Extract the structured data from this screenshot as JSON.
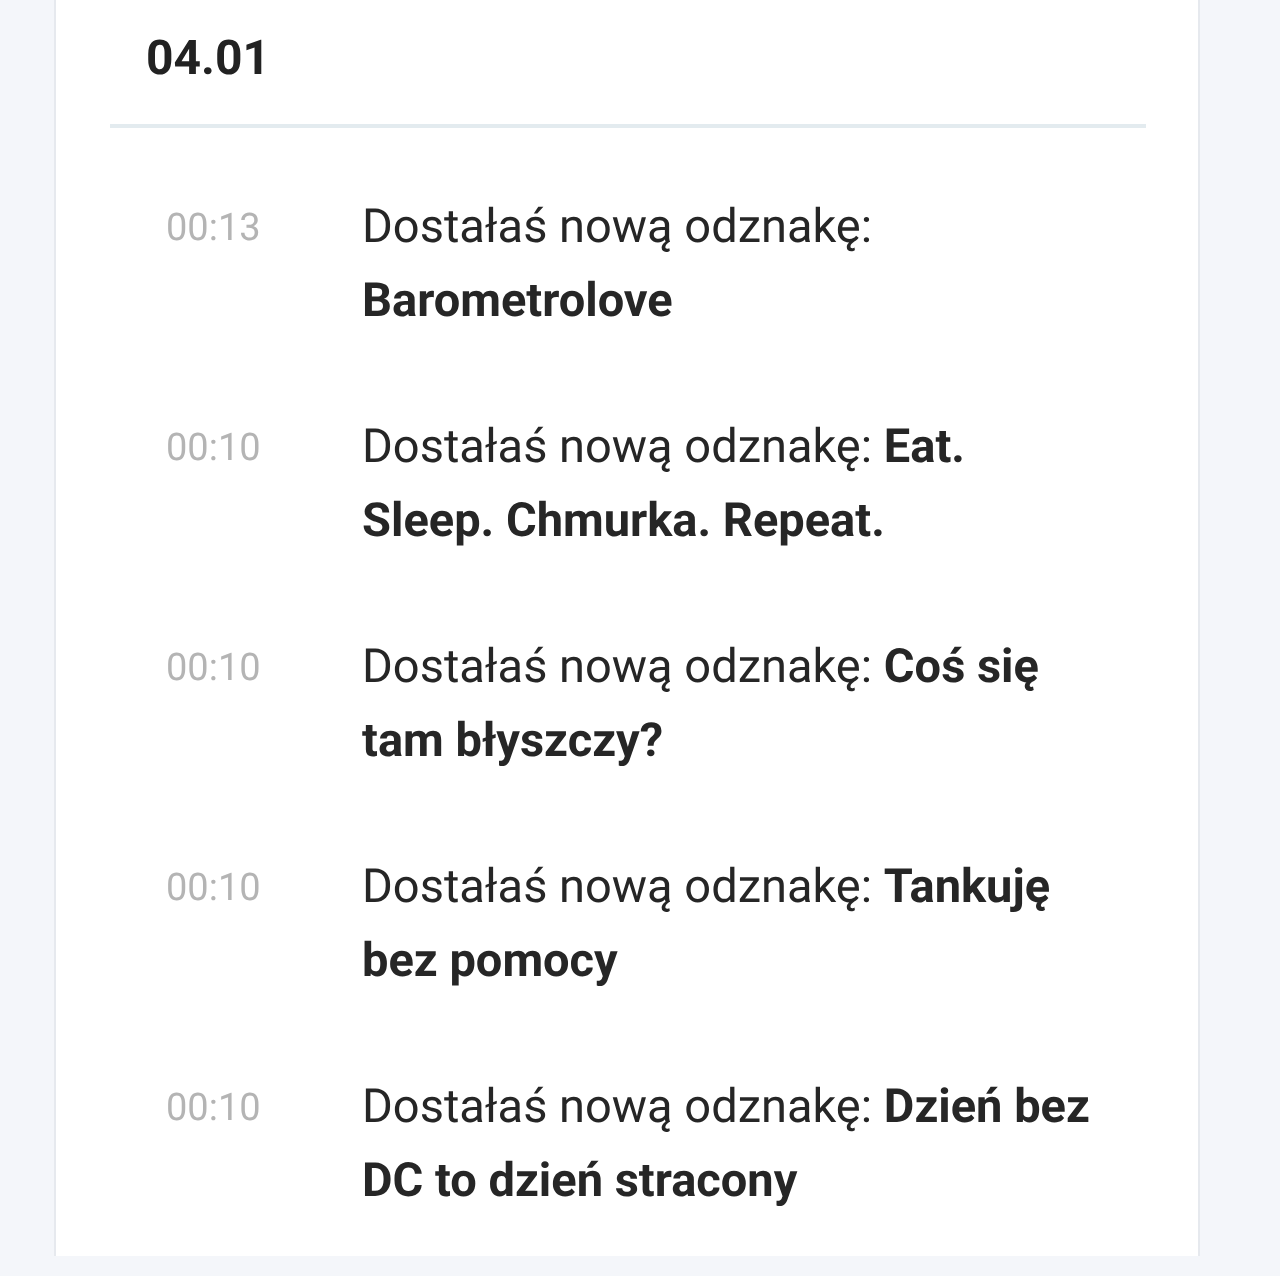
{
  "day": {
    "title": "04.01"
  },
  "notifications": [
    {
      "time": "00:13",
      "text": "Dostałaś nową odznakę: **Barometrolove**"
    },
    {
      "time": "00:10",
      "text": "Dostałaś nową odznakę: **Eat. Sleep. Chmurka. Repeat.**"
    },
    {
      "time": "00:10",
      "text": "Dostałaś nową odznakę: **Coś się tam błyszczy?**"
    },
    {
      "time": "00:10",
      "text": "Dostałaś nową odznakę: **Tankuję bez pomocy**"
    },
    {
      "time": "00:10",
      "text": "Dostałaś nową odznakę: **Dzień bez DC to dzień stracony**"
    }
  ]
}
